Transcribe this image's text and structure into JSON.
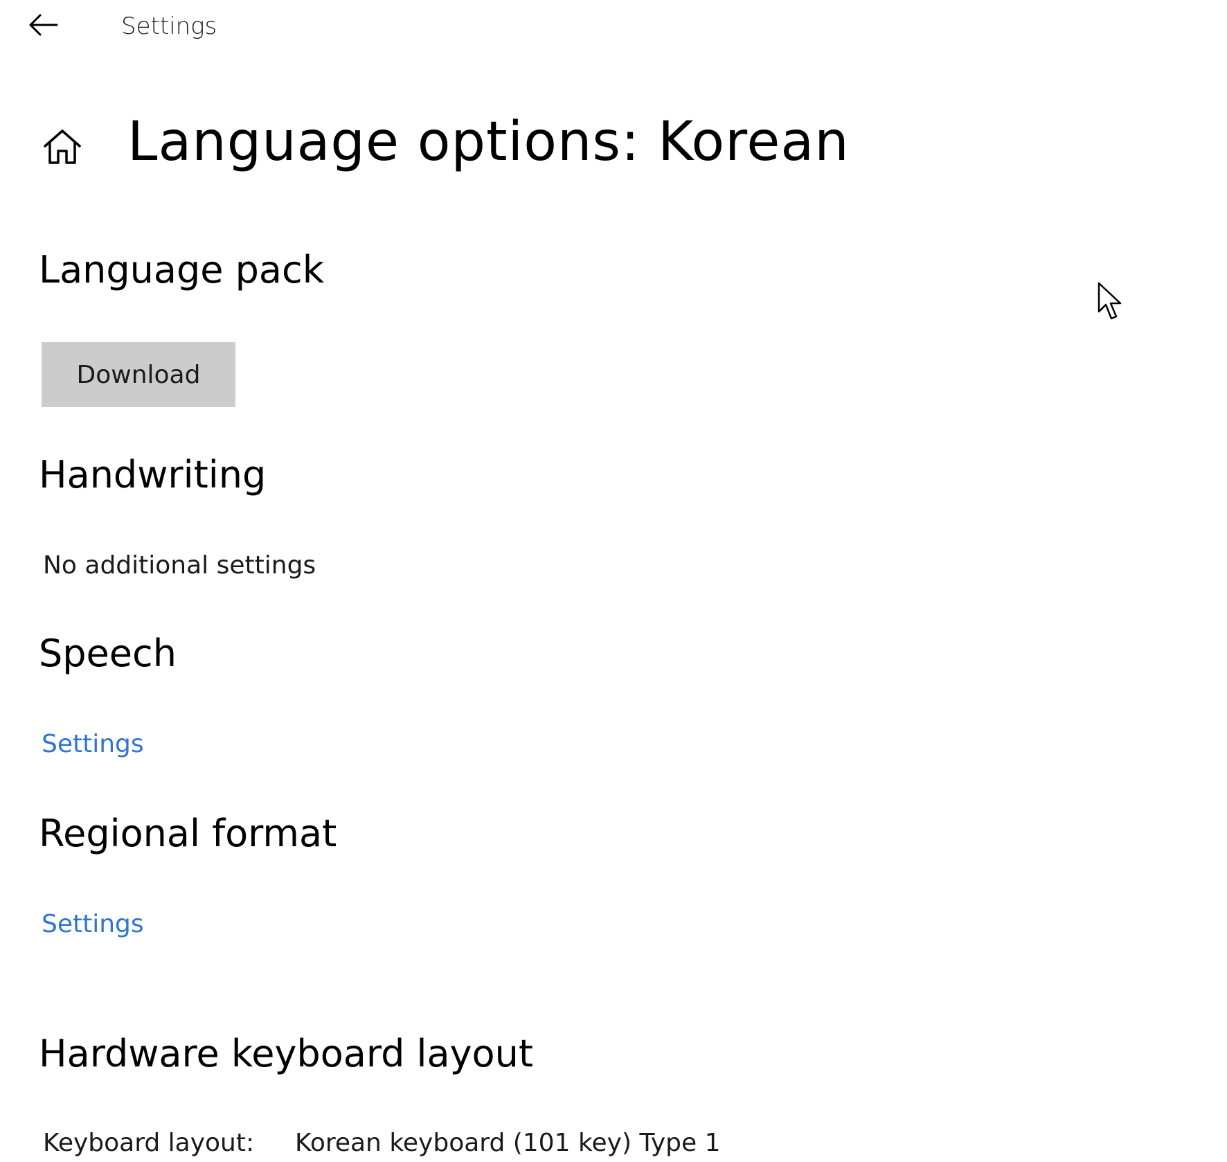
{
  "header": {
    "app_title": "Settings",
    "back_icon": "arrow-left-icon"
  },
  "page": {
    "home_icon": "home-icon",
    "title": "Language options: Korean"
  },
  "sections": {
    "language_pack": {
      "heading": "Language pack",
      "button_label": "Download"
    },
    "handwriting": {
      "heading": "Handwriting",
      "text": "No additional settings"
    },
    "speech": {
      "heading": "Speech",
      "link_label": "Settings"
    },
    "regional_format": {
      "heading": "Regional format",
      "link_label": "Settings"
    },
    "hardware_keyboard": {
      "heading": "Hardware keyboard layout",
      "label": "Keyboard layout:",
      "value": "Korean keyboard (101 key) Type 1"
    }
  },
  "colors": {
    "link": "#2f74d0",
    "button_bg": "#cccccc",
    "background": "#ffffff"
  }
}
